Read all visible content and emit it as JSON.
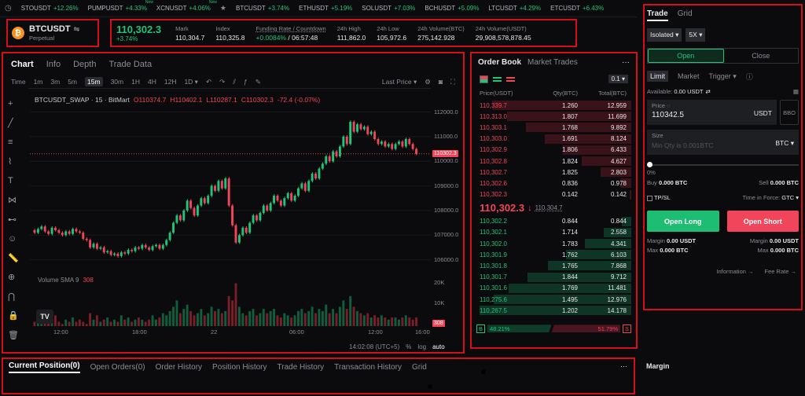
{
  "ticker": [
    {
      "sym": "STOUSDT",
      "chg": "+12.26%",
      "new": false
    },
    {
      "sym": "PUMPUSDT",
      "chg": "+4.33%",
      "new": true
    },
    {
      "sym": "XCNUSDT",
      "chg": "+4.06%",
      "new": true
    },
    {
      "sym": "BTCUSDT",
      "chg": "+3.74%",
      "new": false
    },
    {
      "sym": "ETHUSDT",
      "chg": "+5.19%",
      "new": false
    },
    {
      "sym": "SOLUSDT",
      "chg": "+7.03%",
      "new": false
    },
    {
      "sym": "BCHUSDT",
      "chg": "+5.09%",
      "new": false
    },
    {
      "sym": "LTCUSDT",
      "chg": "+4.29%",
      "new": false
    },
    {
      "sym": "ETCUSDT",
      "chg": "+6.43%",
      "new": false
    }
  ],
  "ticker_new_label": "New",
  "symbol": {
    "name": "BTCUSDT",
    "type": "Perpetual",
    "coin_letter": "₿",
    "swap_icon": "⇋"
  },
  "stats": {
    "last": "110,302.3",
    "change": "+3.74%",
    "items": [
      {
        "label": "Mark",
        "value": "110,304.7"
      },
      {
        "label": "Index",
        "value": "110,325.8"
      },
      {
        "label": "Funding Rate / Countdown",
        "value": "+0.0084%",
        "value2": " / 06:57:48"
      },
      {
        "label": "24h High",
        "value": "111,862.0"
      },
      {
        "label": "24h Low",
        "value": "105,972.6"
      },
      {
        "label": "24h Volume(BTC)",
        "value": "275,142.928"
      },
      {
        "label": "24h Volume(USDT)",
        "value": "29,908,578,878.45"
      }
    ]
  },
  "chart": {
    "tabs": [
      "Chart",
      "Info",
      "Depth",
      "Trade Data"
    ],
    "timeframes": [
      "Time",
      "1m",
      "3m",
      "5m",
      "15m",
      "30m",
      "1H",
      "4H",
      "12H",
      "1D"
    ],
    "active_tf": "15m",
    "last_price_label": "Last Price",
    "legend": "BTCUSDT_SWAP · 15 · BitMart",
    "ohlc": {
      "o": "O110374.7",
      "h": "H110402.1",
      "l": "L110287.1",
      "c": "C110302.3",
      "chg": "-72.4 (-0.07%)"
    },
    "volume_label": "Volume SMA 9",
    "volume_val": "308",
    "price_ticks": [
      "112000.0",
      "111000.0",
      "110000.0",
      "109000.0",
      "108000.0",
      "107000.0",
      "106000.0"
    ],
    "current_price": "110302.3",
    "vol_ticks": [
      "20K",
      "10K"
    ],
    "vol_current": "308",
    "time_ticks": [
      "12:00",
      "18:00",
      "22",
      "06:00",
      "12:00",
      "16:00"
    ],
    "clock": "14:02:08 (UTC+5)",
    "scale_opts": [
      "%",
      "log",
      "auto"
    ],
    "tv_logo": "TV"
  },
  "chart_data": {
    "type": "candlestick",
    "ylim": [
      105700,
      112400
    ],
    "candles": [
      [
        107200,
        107100
      ],
      [
        107100,
        107250
      ],
      [
        107250,
        107350
      ],
      [
        107350,
        107150
      ],
      [
        107150,
        107050
      ],
      [
        107050,
        107300
      ],
      [
        107300,
        107200
      ],
      [
        107200,
        107100
      ],
      [
        107100,
        107000
      ],
      [
        107000,
        107150
      ],
      [
        107150,
        107050
      ],
      [
        107050,
        107250
      ],
      [
        107250,
        107150
      ],
      [
        107150,
        107100
      ],
      [
        107100,
        106850
      ],
      [
        106850,
        106800
      ],
      [
        106800,
        106500
      ],
      [
        106500,
        106650
      ],
      [
        106650,
        106450
      ],
      [
        106450,
        106500
      ],
      [
        106500,
        106300
      ],
      [
        106300,
        106350
      ],
      [
        106350,
        106200
      ],
      [
        106200,
        106250
      ],
      [
        106250,
        106150
      ],
      [
        106150,
        106300
      ],
      [
        106300,
        106250
      ],
      [
        106250,
        106400
      ],
      [
        106400,
        106350
      ],
      [
        106350,
        106500
      ],
      [
        106500,
        106450
      ],
      [
        106450,
        106600
      ],
      [
        106600,
        106500
      ],
      [
        106500,
        106400
      ],
      [
        106400,
        106550
      ],
      [
        106550,
        106600
      ],
      [
        106600,
        106450
      ],
      [
        106450,
        106600
      ],
      [
        106600,
        106800
      ],
      [
        106800,
        107100
      ],
      [
        107100,
        107500
      ],
      [
        107500,
        107800
      ],
      [
        107800,
        107600
      ],
      [
        107600,
        108000
      ],
      [
        108000,
        108400
      ],
      [
        108400,
        108100
      ],
      [
        108100,
        107800
      ],
      [
        107800,
        108200
      ],
      [
        108200,
        108500
      ],
      [
        108500,
        108300
      ],
      [
        108300,
        108600
      ],
      [
        108600,
        109000
      ],
      [
        109000,
        108800
      ],
      [
        108800,
        109200
      ],
      [
        109200,
        108900
      ],
      [
        108900,
        109300
      ],
      [
        109300,
        108200
      ],
      [
        108200,
        107400
      ],
      [
        107400,
        106700
      ],
      [
        106700,
        107000
      ],
      [
        107000,
        107300
      ],
      [
        107300,
        107100
      ],
      [
        107100,
        107500
      ],
      [
        107500,
        107800
      ],
      [
        107800,
        107600
      ],
      [
        107600,
        107900
      ],
      [
        107900,
        108200
      ],
      [
        108200,
        108000
      ],
      [
        108000,
        108300
      ],
      [
        108300,
        108600
      ],
      [
        108600,
        108400
      ],
      [
        108400,
        108200
      ],
      [
        108200,
        108500
      ],
      [
        108500,
        108700
      ],
      [
        108700,
        108400
      ],
      [
        108400,
        108600
      ],
      [
        108600,
        108900
      ],
      [
        108900,
        109100
      ],
      [
        109100,
        108800
      ],
      [
        108800,
        109200
      ],
      [
        109200,
        109500
      ],
      [
        109500,
        109300
      ],
      [
        109300,
        109700
      ],
      [
        109700,
        109900
      ],
      [
        109900,
        110200
      ],
      [
        110200,
        110000
      ],
      [
        110000,
        110400
      ],
      [
        110400,
        110200
      ],
      [
        110200,
        110600
      ],
      [
        110600,
        111000
      ],
      [
        111000,
        110700
      ],
      [
        110700,
        111600
      ],
      [
        111600,
        111200
      ],
      [
        111200,
        111500
      ],
      [
        111500,
        111300
      ],
      [
        111300,
        111400
      ],
      [
        111400,
        111100
      ],
      [
        111100,
        111200
      ],
      [
        111200,
        110900
      ],
      [
        110900,
        110700
      ],
      [
        110700,
        110800
      ],
      [
        110800,
        110600
      ],
      [
        110600,
        110700
      ],
      [
        110700,
        110500
      ],
      [
        110500,
        110700
      ],
      [
        110700,
        110800
      ],
      [
        110800,
        110600
      ],
      [
        110600,
        110900
      ],
      [
        110900,
        110700
      ],
      [
        110700,
        110500
      ],
      [
        110500,
        110300
      ]
    ]
  },
  "drawtools": [
    "crosshair-icon",
    "trendline-icon",
    "fib-icon",
    "brush-icon",
    "text-icon",
    "pattern-icon",
    "measure-icon",
    "emoji-icon",
    "ruler-icon",
    "zoom-icon",
    "magnet-icon",
    "lock-icon",
    "trash-icon"
  ],
  "orderbook": {
    "tabs": [
      "Order Book",
      "Market Trades"
    ],
    "precision": "0.1",
    "headers": [
      "Price(USDT)",
      "Qty(BTC)",
      "Total(BTC)"
    ],
    "asks": [
      [
        "110,339.7",
        "1.260",
        "12.959",
        0.9
      ],
      [
        "110,313.0",
        "1.807",
        "11.699",
        0.8
      ],
      [
        "110,303.1",
        "1.768",
        "9.892",
        0.68
      ],
      [
        "110,303.0",
        "1.691",
        "8.124",
        0.56
      ],
      [
        "110,302.9",
        "1.806",
        "6.433",
        0.44
      ],
      [
        "110,302.8",
        "1.824",
        "4.627",
        0.32
      ],
      [
        "110,302.7",
        "1.825",
        "2.803",
        0.2
      ],
      [
        "110,302.6",
        "0.836",
        "0.978",
        0.07
      ],
      [
        "110,302.3",
        "0.142",
        "0.142",
        0.01
      ]
    ],
    "last": "110,302.3",
    "last_arrow": "↓",
    "mark": "110,304.7",
    "bids": [
      [
        "110,302.2",
        "0.844",
        "0.844",
        0.06
      ],
      [
        "110,302.1",
        "1.714",
        "2.558",
        0.18
      ],
      [
        "110,302.0",
        "1.783",
        "4.341",
        0.3
      ],
      [
        "110,301.9",
        "1.762",
        "6.103",
        0.42
      ],
      [
        "110,301.8",
        "1.765",
        "7.868",
        0.54
      ],
      [
        "110,301.7",
        "1.844",
        "9.712",
        0.67
      ],
      [
        "110,301.6",
        "1.769",
        "11.481",
        0.79
      ],
      [
        "110,275.6",
        "1.495",
        "12.976",
        0.89
      ],
      [
        "110,267.5",
        "1.202",
        "14.178",
        0.98
      ]
    ],
    "buy_label": "B",
    "buy_pct": "48.21%",
    "sell_pct": "51.79%",
    "sell_label": "S",
    "buy_ratio": 0.4821
  },
  "trade": {
    "tabs": [
      "Trade",
      "Grid"
    ],
    "margin_mode": "Isolated",
    "leverage": "5X",
    "open": "Open",
    "close": "Close",
    "types": [
      "Limit",
      "Market",
      "Trigger"
    ],
    "available_label": "Available:",
    "available": "0.00 USDT",
    "price_label": "Price",
    "price_value": "110342.5",
    "price_unit": "USDT",
    "bbo": "BBO",
    "size_label": "Size",
    "size_placeholder": "Min Qty is 0.001BTC",
    "size_unit": "BTC",
    "slider_pct": "0%",
    "buy_label": "Buy",
    "buy_val": "0.000 BTC",
    "sell_label": "Sell",
    "sell_val": "0.000 BTC",
    "tpsl": "TP/SL",
    "tif_label": "Time in Force:",
    "tif": "GTC",
    "open_long": "Open Long",
    "open_short": "Open Short",
    "margin_l_label": "Margin",
    "margin_l": "0.00 USDT",
    "max_l_label": "Max",
    "max_l": "0.000 BTC",
    "margin_r_label": "Margin",
    "margin_r": "0.00 USDT",
    "max_r_label": "Max",
    "max_r": "0.000 BTC",
    "info_link": "Information",
    "fee_link": "Fee Rate",
    "colors": {
      "long": "#1dbd74",
      "short": "#f0455a"
    }
  },
  "bottom": {
    "tabs": [
      "Current Position(0)",
      "Open Orders(0)",
      "Order History",
      "Position History",
      "Trade History",
      "Transaction History",
      "Grid"
    ],
    "side_title": "Margin",
    "more": "···"
  }
}
